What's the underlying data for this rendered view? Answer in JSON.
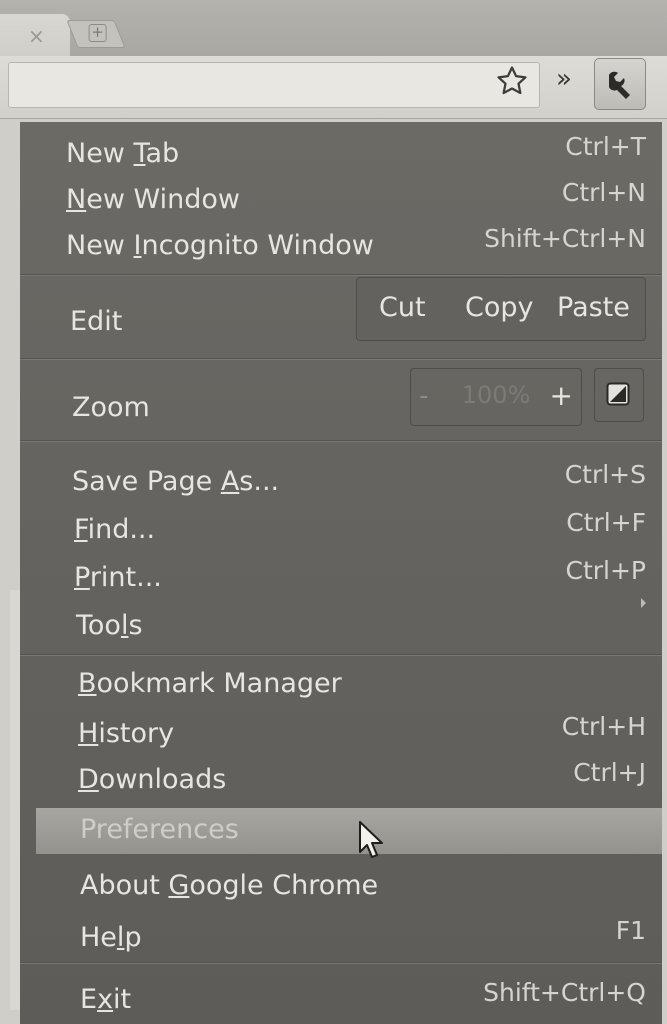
{
  "tabs": {
    "close_glyph": "×",
    "new_tab_glyph": "+"
  },
  "toolbar": {
    "chevron_glyph": "»"
  },
  "menu": {
    "new_tab": {
      "label_pre": "New ",
      "label_ul": "T",
      "label_post": "ab",
      "accel": "Ctrl+T"
    },
    "new_window": {
      "label_pre": "",
      "label_ul": "N",
      "label_post": "ew Window",
      "accel": "Ctrl+N"
    },
    "new_incognito": {
      "label_pre": "New ",
      "label_ul": "I",
      "label_post": "ncognito Window",
      "accel": "Shift+Ctrl+N"
    },
    "edit": {
      "label": "Edit",
      "cut": "Cut",
      "copy": "Copy",
      "paste": "Paste"
    },
    "zoom": {
      "label": "Zoom",
      "minus": "-",
      "value": "100%",
      "plus": "+"
    },
    "save_page": {
      "label_pre": "Save Page ",
      "label_ul": "A",
      "label_post": "s...",
      "accel": "Ctrl+S"
    },
    "find": {
      "label_pre": "",
      "label_ul": "F",
      "label_post": "ind...",
      "accel": "Ctrl+F"
    },
    "print": {
      "label_pre": "",
      "label_ul": "P",
      "label_post": "rint...",
      "accel": "Ctrl+P"
    },
    "tools": {
      "label_pre": "Too",
      "label_ul": "l",
      "label_post": "s"
    },
    "bookmark_manager": {
      "label_pre": "",
      "label_ul": "B",
      "label_post": "ookmark Manager"
    },
    "history": {
      "label_pre": "",
      "label_ul": "H",
      "label_post": "istory",
      "accel": "Ctrl+H"
    },
    "downloads": {
      "label_pre": "",
      "label_ul": "D",
      "label_post": "ownloads",
      "accel": "Ctrl+J"
    },
    "preferences": {
      "label": "Preferences"
    },
    "about": {
      "label_pre": "About ",
      "label_ul": "G",
      "label_post": "oogle Chrome"
    },
    "help": {
      "label_pre": "He",
      "label_ul": "l",
      "label_post": "p",
      "accel": "F1"
    },
    "exit": {
      "label_pre": "E",
      "label_ul": "x",
      "label_post": "it",
      "accel": "Shift+Ctrl+Q"
    }
  }
}
